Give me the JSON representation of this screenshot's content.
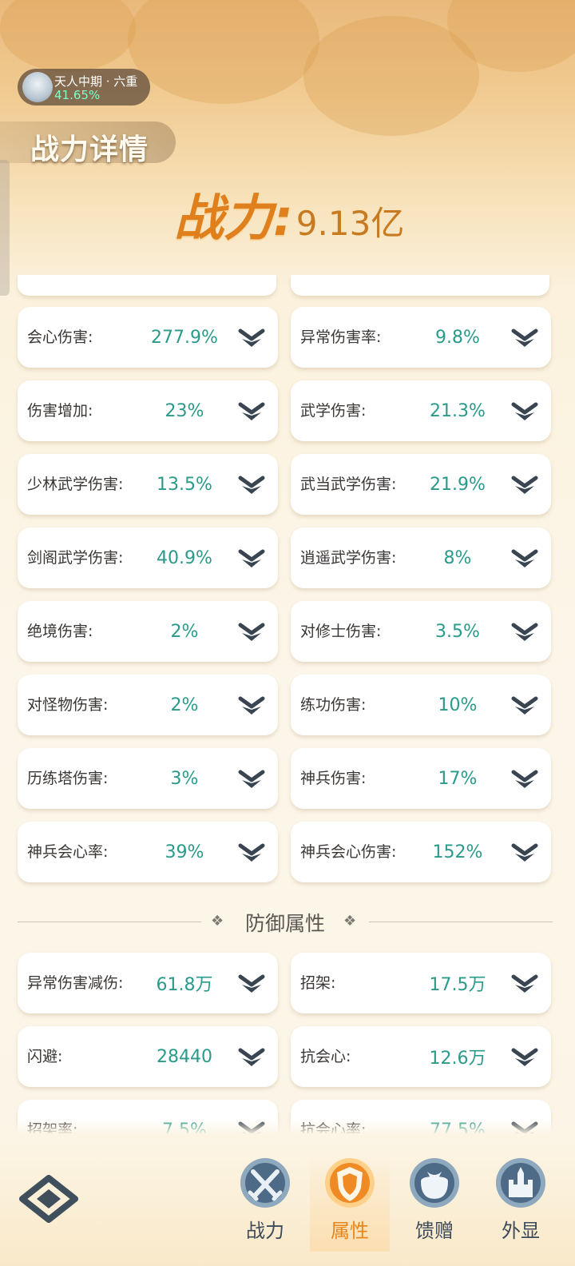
{
  "header": {
    "realm": {
      "name": "天人中期 · 六重",
      "progress": "41.65%"
    },
    "page_title": "战力详情",
    "power": {
      "label": "战力:",
      "value": "9.13亿"
    }
  },
  "attack_stats": [
    {
      "label": "会心伤害:",
      "value": "277.9%"
    },
    {
      "label": "异常伤害率:",
      "value": "9.8%"
    },
    {
      "label": "伤害增加:",
      "value": "23%"
    },
    {
      "label": "武学伤害:",
      "value": "21.3%"
    },
    {
      "label": "少林武学伤害:",
      "value": "13.5%"
    },
    {
      "label": "武当武学伤害:",
      "value": "21.9%"
    },
    {
      "label": "剑阁武学伤害:",
      "value": "40.9%"
    },
    {
      "label": "逍遥武学伤害:",
      "value": "8%"
    },
    {
      "label": "绝境伤害:",
      "value": "2%"
    },
    {
      "label": "对修士伤害:",
      "value": "3.5%"
    },
    {
      "label": "对怪物伤害:",
      "value": "2%"
    },
    {
      "label": "练功伤害:",
      "value": "10%"
    },
    {
      "label": "历练塔伤害:",
      "value": "3%"
    },
    {
      "label": "神兵伤害:",
      "value": "17%"
    },
    {
      "label": "神兵会心率:",
      "value": "39%"
    },
    {
      "label": "神兵会心伤害:",
      "value": "152%"
    }
  ],
  "defense_section": {
    "title": "防御属性",
    "stats": [
      {
        "label": "异常伤害减伤:",
        "value": "61.8万"
      },
      {
        "label": "招架:",
        "value": "17.5万"
      },
      {
        "label": "闪避:",
        "value": "28440"
      },
      {
        "label": "抗会心:",
        "value": "12.6万"
      },
      {
        "label": "招架率:",
        "value": "7.5%"
      },
      {
        "label": "抗会心率:",
        "value": "77.5%"
      }
    ]
  },
  "bottom_nav": {
    "tabs": [
      {
        "label": "战力",
        "icon": "swords-icon",
        "active": false
      },
      {
        "label": "属性",
        "icon": "shield-icon",
        "active": true
      },
      {
        "label": "馈赠",
        "icon": "gift-bag-icon",
        "active": false
      },
      {
        "label": "外显",
        "icon": "castle-icon",
        "active": false
      }
    ]
  },
  "colors": {
    "value_teal": "#2a9a8a",
    "power_orange": "#e0801c",
    "active_tab": "#e8861d",
    "nav_icon_blue": "#4d6a86"
  }
}
